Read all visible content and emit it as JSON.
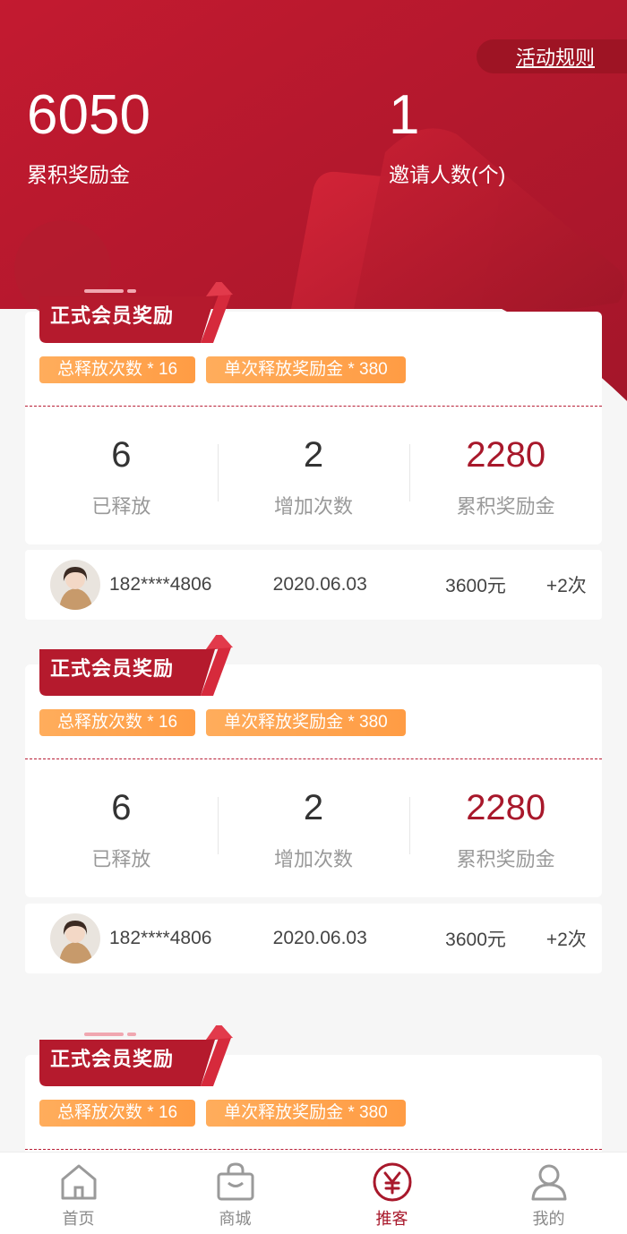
{
  "header": {
    "rules_label": "活动规则",
    "total_reward": {
      "value": "6050",
      "label": "累积奖励金"
    },
    "invites": {
      "value": "1",
      "label": "邀请人数(个)"
    }
  },
  "cards": [
    {
      "title": "正式会员奖励",
      "tags": [
        "总释放次数 * 16",
        "单次释放奖励金 * 380"
      ],
      "released": {
        "value": "6",
        "label": "已释放"
      },
      "added": {
        "value": "2",
        "label": "增加次数"
      },
      "accumulated": {
        "value": "2280",
        "label": "累积奖励金"
      },
      "record": {
        "phone": "182****4806",
        "date": "2020.06.03",
        "amount": "3600元",
        "count": "+2次"
      }
    },
    {
      "title": "正式会员奖励",
      "tags": [
        "总释放次数 * 16",
        "单次释放奖励金 * 380"
      ],
      "released": {
        "value": "6",
        "label": "已释放"
      },
      "added": {
        "value": "2",
        "label": "增加次数"
      },
      "accumulated": {
        "value": "2280",
        "label": "累积奖励金"
      },
      "record": {
        "phone": "182****4806",
        "date": "2020.06.03",
        "amount": "3600元",
        "count": "+2次"
      }
    },
    {
      "title": "正式会员奖励",
      "tags": [
        "总释放次数 * 16",
        "单次释放奖励金 * 380"
      ]
    }
  ],
  "tabbar": {
    "items": [
      {
        "label": "首页",
        "icon": "home-icon"
      },
      {
        "label": "商城",
        "icon": "shopping-bag-icon"
      },
      {
        "label": "推客",
        "icon": "yuan-icon"
      },
      {
        "label": "我的",
        "icon": "user-icon"
      }
    ],
    "active": "推客"
  },
  "colors": {
    "brand_red": "#a8182b",
    "tag_orange": "#ffa04c"
  }
}
